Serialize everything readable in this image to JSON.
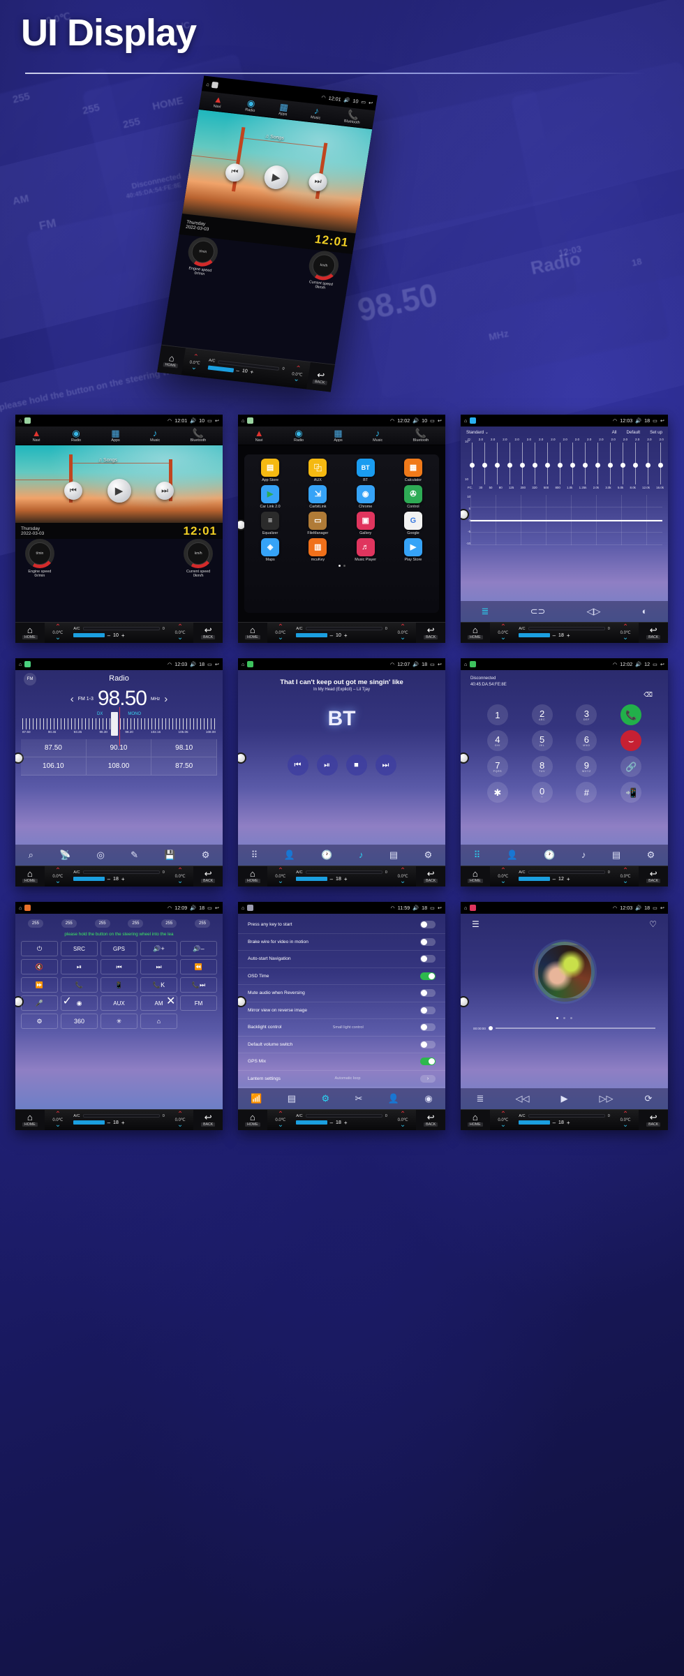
{
  "header": {
    "title": "UI Display"
  },
  "climate_bar": {
    "home_label": "HOME",
    "back_label": "BACK",
    "temp_left": "0.0℃",
    "temp_right": "0.0℃",
    "ac_label": "A/C",
    "fan_zero": "0",
    "minus": "–",
    "plus": "+",
    "levels": {
      "ten": "10",
      "eighteen": "18",
      "twelve": "12"
    }
  },
  "quickbar": {
    "items": [
      {
        "label": "Navi",
        "icon": "navigation-arrow-icon"
      },
      {
        "label": "Radio",
        "icon": "radio-antenna-icon"
      },
      {
        "label": "Apps",
        "icon": "apps-grid-icon"
      },
      {
        "label": "Music",
        "icon": "music-note-icon"
      },
      {
        "label": "Bluetooth",
        "icon": "phone-handset-icon"
      }
    ]
  },
  "screens": {
    "home": {
      "status": {
        "time": "12:01",
        "volume": "10"
      },
      "songs_label": "Songs",
      "day": "Thursday",
      "date": "2022-03-03",
      "clock": "12:01",
      "gauge_left": {
        "unit": "t/min",
        "label": "Engine speed",
        "value": "0r/min"
      },
      "gauge_right": {
        "unit": "km/h",
        "label": "Current speed",
        "value": "0km/h"
      },
      "fan_level": "10"
    },
    "apps": {
      "status": {
        "time": "12:02",
        "volume": "10"
      },
      "items": [
        {
          "label": "App Store",
          "glyph": "▤",
          "color": "#f5b911"
        },
        {
          "label": "AUX",
          "glyph": "⿻",
          "color": "#f5b911"
        },
        {
          "label": "BT",
          "glyph": "BT",
          "color": "#1a9cf0"
        },
        {
          "label": "Calculator",
          "glyph": "▦",
          "color": "#f07a1a"
        },
        {
          "label": "Car Link 2.0",
          "glyph": "▶",
          "color": "#36a3f7"
        },
        {
          "label": "CarbitLink",
          "glyph": "⇲",
          "color": "#36a3f7"
        },
        {
          "label": "Chrome",
          "glyph": "◉",
          "color": "#36a3f7"
        },
        {
          "label": "Control",
          "glyph": "✇",
          "color": "#2eab55"
        },
        {
          "label": "Equalizer",
          "glyph": "≡",
          "color": "#2b2b2b"
        },
        {
          "label": "FileManager",
          "glyph": "▭",
          "color": "#b07b37"
        },
        {
          "label": "Gallery",
          "glyph": "▣",
          "color": "#e0355e"
        },
        {
          "label": "Google",
          "glyph": "G",
          "color": "#f2f2f2"
        },
        {
          "label": "Maps",
          "glyph": "◈",
          "color": "#36a3f7"
        },
        {
          "label": "mcuKey",
          "glyph": "▥",
          "color": "#f0701a"
        },
        {
          "label": "Music Player",
          "glyph": "♬",
          "color": "#e0355e"
        },
        {
          "label": "Play Store",
          "glyph": "▶",
          "color": "#36a3f7"
        }
      ],
      "fan_level": "10"
    },
    "equalizer": {
      "status": {
        "time": "12:03",
        "volume": "18"
      },
      "preset": "Standard",
      "actions": [
        "All",
        "Default",
        "Set up"
      ],
      "q_label": "Q:",
      "fc_label": "FC.",
      "q_values": [
        "2.0",
        "2.0",
        "2.0",
        "2.0",
        "2.0",
        "2.0",
        "2.0",
        "2.0",
        "2.0",
        "2.0",
        "2.0",
        "2.0",
        "2.0",
        "2.0",
        "2.0",
        "2.0"
      ],
      "frequencies": [
        "30",
        "50",
        "80",
        "125",
        "200",
        "320",
        "500",
        "800",
        "1.0k",
        "1.25k",
        "2.0k",
        "3.0k",
        "5.0k",
        "8.0k",
        "12.0k",
        "16.0k"
      ],
      "scale_top": "10",
      "scale_bottom": "10",
      "chart_y_labels": [
        "10",
        "5",
        "0",
        "-5",
        "-10"
      ],
      "fan_level": "18"
    },
    "radio": {
      "status": {
        "time": "12:03",
        "volume": "18"
      },
      "band_chip": "FM",
      "title": "Radio",
      "band": "FM 1-3",
      "frequency": "98.50",
      "unit": "MHz",
      "dx_label": "DX",
      "mono_label": "MONO",
      "scale": [
        "87.50",
        "90.45",
        "93.35",
        "96.30",
        "99.20",
        "102.15",
        "105.05",
        "108.00"
      ],
      "presets": [
        "87.50",
        "90.10",
        "98.10",
        "106.10",
        "108.00",
        "87.50"
      ],
      "fan_level": "18"
    },
    "bt_music": {
      "status": {
        "time": "12:07",
        "volume": "18"
      },
      "track_line": "That I can't keep out got me singin' like",
      "track_sub": "In My Head (Explicit) – Lil Tjay",
      "logo": "BT",
      "fan_level": "18"
    },
    "dialpad": {
      "status": {
        "time": "12:02",
        "volume": "12"
      },
      "connection": "Disconnected",
      "mac": "40:45:DA:54:FE:8E",
      "keys": [
        {
          "num": "1",
          "sub": ""
        },
        {
          "num": "2",
          "sub": "ABC"
        },
        {
          "num": "3",
          "sub": "DEF"
        },
        {
          "num": "4",
          "sub": "GHI"
        },
        {
          "num": "5",
          "sub": "JKL"
        },
        {
          "num": "6",
          "sub": "MNO"
        },
        {
          "num": "7",
          "sub": "PQRS"
        },
        {
          "num": "8",
          "sub": "TUV"
        },
        {
          "num": "9",
          "sub": "WXYZ"
        },
        {
          "num": "✱",
          "sub": ""
        },
        {
          "num": "0",
          "sub": "+"
        },
        {
          "num": "#",
          "sub": ""
        }
      ],
      "fan_level": "12"
    },
    "steering": {
      "status": {
        "time": "12:09",
        "volume": "18"
      },
      "pills": [
        "255",
        "255",
        "255",
        "255",
        "255",
        "255"
      ],
      "message": "please hold the button on the steering wheel into the lea",
      "buttons": [
        "⏻",
        "SRC",
        "GPS",
        "🔊+",
        "🔊–",
        "🔇",
        "⏯",
        "⏮",
        "⏭",
        "⏪",
        "⏩",
        "📞",
        "📱",
        "📞K",
        "📞⏭",
        "🎤",
        "◉",
        "AUX",
        "AM",
        "FM",
        "⚙",
        "360",
        "✳",
        "⌂"
      ],
      "confirm": "✓",
      "cancel": "✕",
      "fan_level": "18"
    },
    "settings": {
      "status": {
        "time": "11:59",
        "volume": "18"
      },
      "rows": [
        {
          "label": "Press any key to start",
          "sub": "",
          "state": "off"
        },
        {
          "label": "Brake wire for video in motion",
          "sub": "",
          "state": "off"
        },
        {
          "label": "Auto-start Navigation",
          "sub": "",
          "state": "off"
        },
        {
          "label": "OSD Time",
          "sub": "",
          "state": "on"
        },
        {
          "label": "Mute audio when Reversing",
          "sub": "",
          "state": "off"
        },
        {
          "label": "Mirror view on reverse image",
          "sub": "",
          "state": "off"
        },
        {
          "label": "Backlight control",
          "sub": "Small light control",
          "state": "off"
        },
        {
          "label": "Default volume switch",
          "sub": "",
          "state": "off"
        },
        {
          "label": "GPS Mix",
          "sub": "",
          "state": "on"
        },
        {
          "label": "Lantern settings",
          "sub": "Automatic loop",
          "state": "arrow"
        }
      ],
      "fan_level": "18"
    },
    "music_player": {
      "status": {
        "time": "12:03",
        "volume": "18"
      },
      "elapsed": "00:00:00",
      "fan_level": "18"
    }
  },
  "ghost_texts": {
    "a": "255",
    "b": "255",
    "c": "255",
    "d": "Radio",
    "e": "98.50",
    "f": "MHz",
    "g": "FM 1-3",
    "h": "12:03",
    "i": "18",
    "j": "BACK",
    "k": "HOME",
    "l": "0.0℃",
    "m": "AM",
    "n": "FM",
    "o": "Disconnected",
    "p": "40:45:DA:54:FE:8E",
    "q": "A/C",
    "r": "87.50",
    "s": "90.45",
    "t": "please hold the button on the steering wheel into the lea"
  },
  "colors": {
    "accent_cyan": "#2ad7f5",
    "accent_blue": "#1b9fe0",
    "accent_green": "#2db84d",
    "accent_red": "#e2323c",
    "clock_yellow": "#f2d024",
    "bg_deep": "#12123f"
  }
}
